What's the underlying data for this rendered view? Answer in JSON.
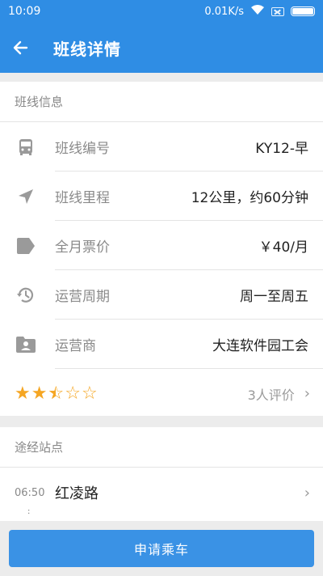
{
  "status_bar": {
    "time": "10:09",
    "network_speed": "0.01K/s",
    "icons": [
      "wifi-icon",
      "sim-card-icon",
      "battery-icon"
    ]
  },
  "app_bar": {
    "title": "班线详情",
    "back_icon": "arrow-left-icon"
  },
  "route_info": {
    "section_title": "班线信息",
    "rows": [
      {
        "icon": "bus-icon",
        "label": "班线编号",
        "value": "KY12-早"
      },
      {
        "icon": "navigation-icon",
        "label": "班线里程",
        "value": "12公里，约60分钟"
      },
      {
        "icon": "tag-icon",
        "label": "全月票价",
        "value": "￥40/月"
      },
      {
        "icon": "history-icon",
        "label": "运营周期",
        "value": "周一至周五"
      },
      {
        "icon": "folder-user-icon",
        "label": "运营商",
        "value": "大连软件园工会"
      }
    ],
    "rating": {
      "stars": 2.5,
      "max_stars": 5,
      "reviews_text": "3人评价"
    }
  },
  "stops": {
    "section_title": "途经站点",
    "items": [
      {
        "time": "06:50",
        "name": "红凌路"
      }
    ]
  },
  "actions": {
    "apply_label": "申请乘车"
  },
  "colors": {
    "primary": "#2f8de4",
    "button": "#3a92e5",
    "star": "#f5a623",
    "background": "#ececec"
  }
}
